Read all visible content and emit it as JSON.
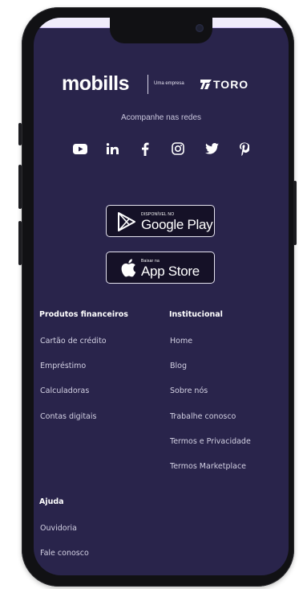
{
  "brand": {
    "logo_text": "mobills",
    "tagline": "Uma empresa",
    "partner_text": "TORO"
  },
  "social": {
    "heading": "Acompanhe nas redes",
    "icons": [
      "youtube-icon",
      "linkedin-icon",
      "facebook-icon",
      "instagram-icon",
      "twitter-icon",
      "pinterest-icon"
    ]
  },
  "stores": {
    "google": {
      "small": "DISPONÍVEL NO",
      "big": "Google Play"
    },
    "apple": {
      "small": "Baixar na",
      "big": "App Store"
    }
  },
  "footer": {
    "produtos": {
      "title": "Produtos financeiros",
      "links": [
        "Cartão de crédito",
        "Empréstimo",
        "Calculadoras",
        "Contas digitais"
      ]
    },
    "institucional": {
      "title": "Institucional",
      "links": [
        "Home",
        "Blog",
        "Sobre nós",
        "Trabalhe conosco",
        "Termos e Privacidade",
        "Termos Marketplace"
      ]
    },
    "ajuda": {
      "title": "Ajuda",
      "links": [
        "Ouvidoria",
        "Fale conosco"
      ]
    }
  },
  "colors": {
    "background": "#29244b",
    "text": "#ffffff",
    "link": "#d3d1e3",
    "phone_frame": "#111114"
  }
}
